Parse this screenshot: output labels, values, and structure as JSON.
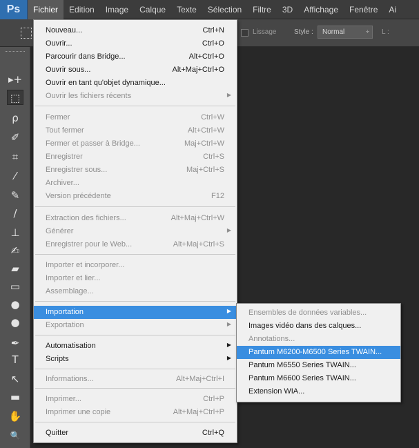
{
  "menubar": {
    "logo": "Ps",
    "items": [
      "Fichier",
      "Edition",
      "Image",
      "Calque",
      "Texte",
      "Sélection",
      "Filtre",
      "3D",
      "Affichage",
      "Fenêtre",
      "Ai"
    ]
  },
  "options_bar": {
    "lissage": "Lissage",
    "style_label": "Style :",
    "style_value": "Normal",
    "style_arrow": "÷",
    "width_label": "L :"
  },
  "tools": {
    "move": "▸+",
    "marquee": "⬚",
    "lasso": "ρ",
    "quick_select": "✐",
    "crop": "⌗",
    "eyedropper": "⁄",
    "healing": "✎",
    "brush": "∕",
    "stamp": "⊥",
    "history_brush": "✍",
    "eraser": "▰",
    "gradient": "▭",
    "blur": "●",
    "dodge": "●",
    "pen": "✒",
    "type": "T",
    "path_select": "↖",
    "shape": "▬",
    "hand": "✋",
    "zoom": "🔍"
  },
  "fichier_menu": {
    "nouveau": {
      "label": "Nouveau...",
      "shortcut": "Ctrl+N"
    },
    "ouvrir": {
      "label": "Ouvrir...",
      "shortcut": "Ctrl+O"
    },
    "bridge": {
      "label": "Parcourir dans Bridge...",
      "shortcut": "Alt+Ctrl+O"
    },
    "ouvrir_sous": {
      "label": "Ouvrir sous...",
      "shortcut": "Alt+Maj+Ctrl+O"
    },
    "objet_dyn": {
      "label": "Ouvrir en tant qu'objet dynamique..."
    },
    "recents": {
      "label": "Ouvrir les fichiers récents"
    },
    "fermer": {
      "label": "Fermer",
      "shortcut": "Ctrl+W"
    },
    "tout_fermer": {
      "label": "Tout fermer",
      "shortcut": "Alt+Ctrl+W"
    },
    "fermer_bridge": {
      "label": "Fermer et passer à Bridge...",
      "shortcut": "Maj+Ctrl+W"
    },
    "enregistrer": {
      "label": "Enregistrer",
      "shortcut": "Ctrl+S"
    },
    "enregistrer_sous": {
      "label": "Enregistrer sous...",
      "shortcut": "Maj+Ctrl+S"
    },
    "archiver": {
      "label": "Archiver..."
    },
    "version_prec": {
      "label": "Version précédente",
      "shortcut": "F12"
    },
    "extraction": {
      "label": "Extraction des fichiers...",
      "shortcut": "Alt+Maj+Ctrl+W"
    },
    "generer": {
      "label": "Générer"
    },
    "web": {
      "label": "Enregistrer pour le Web...",
      "shortcut": "Alt+Maj+Ctrl+S"
    },
    "importer_incorp": {
      "label": "Importer et incorporer..."
    },
    "importer_lier": {
      "label": "Importer et lier..."
    },
    "assemblage": {
      "label": "Assemblage..."
    },
    "importation": {
      "label": "Importation"
    },
    "exportation": {
      "label": "Exportation"
    },
    "automatisation": {
      "label": "Automatisation"
    },
    "scripts": {
      "label": "Scripts"
    },
    "informations": {
      "label": "Informations...",
      "shortcut": "Alt+Maj+Ctrl+I"
    },
    "imprimer": {
      "label": "Imprimer...",
      "shortcut": "Ctrl+P"
    },
    "imprimer_copie": {
      "label": "Imprimer une copie",
      "shortcut": "Alt+Maj+Ctrl+P"
    },
    "quitter": {
      "label": "Quitter",
      "shortcut": "Ctrl+Q"
    },
    "arrow": "▶"
  },
  "import_submenu": {
    "items": [
      "Ensembles de données variables...",
      "Images vidéo dans des calques...",
      "Annotations...",
      "Pantum M6200-M6500 Series TWAIN...",
      "Pantum M6550 Series TWAIN...",
      "Pantum M6600 Series TWAIN...",
      "Extension WIA..."
    ]
  },
  "colors": {
    "highlight": "#3a8ee0",
    "menu_bg": "#f0f0f0",
    "workspace": "#282828",
    "ps_logo": "#2f6fb0"
  }
}
